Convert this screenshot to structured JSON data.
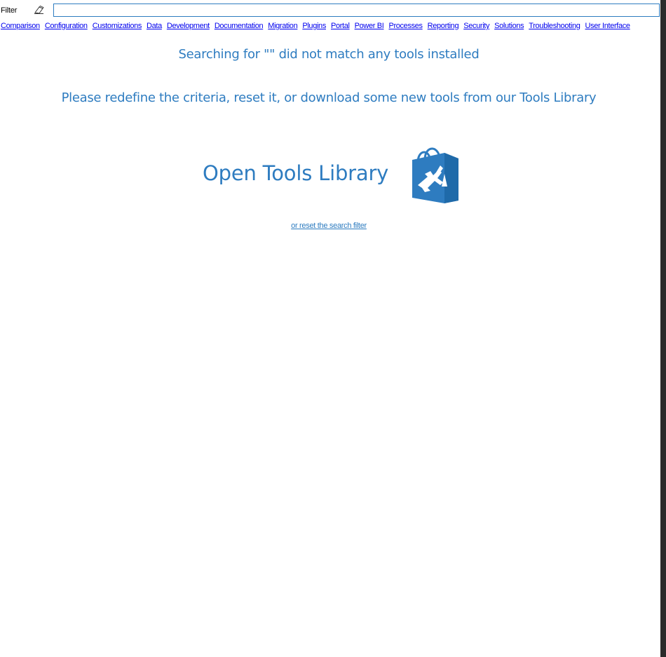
{
  "filter": {
    "label": "Filter",
    "value": "",
    "clear_icon": "eraser-icon"
  },
  "categories": [
    "Comparison",
    "Configuration",
    "Customizations",
    "Data",
    "Development",
    "Documentation",
    "Migration",
    "Plugins",
    "Portal",
    "Power BI",
    "Processes",
    "Reporting",
    "Security",
    "Solutions",
    "Troubleshooting",
    "User Interface"
  ],
  "messages": {
    "no_match": "Searching for \"\" did not match any tools installed",
    "redefine": "Please redefine the criteria, reset it, or download some new tools from our Tools Library"
  },
  "library": {
    "label": "Open Tools Library",
    "icon": "shopping-bag-tools-icon"
  },
  "reset_link": "or reset the search filter",
  "colors": {
    "accent": "#2e7cc0",
    "link": "#0000ee",
    "dark_edge": "#2b2b2b"
  }
}
